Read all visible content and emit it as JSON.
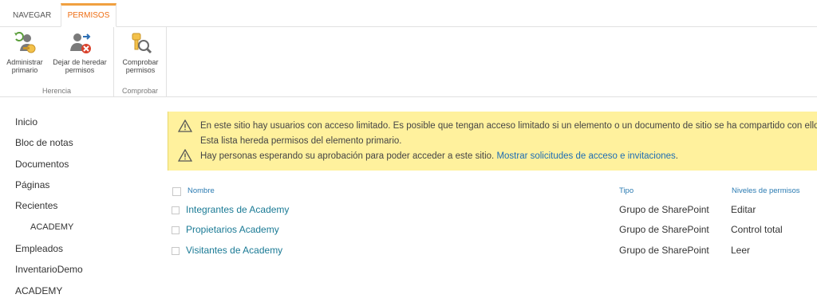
{
  "ribbon": {
    "tabs": [
      {
        "label": "NAVEGAR"
      },
      {
        "label": "PERMISOS",
        "active": true
      }
    ],
    "groups": {
      "herencia": {
        "label": "Herencia",
        "buttons": [
          {
            "line1": "Administrar",
            "line2": "primario",
            "icon": "manage-parent-icon"
          },
          {
            "line1": "Dejar de heredar",
            "line2": "permisos",
            "icon": "stop-inheriting-icon"
          }
        ]
      },
      "comprobar": {
        "label": "Comprobar",
        "buttons": [
          {
            "line1": "Comprobar",
            "line2": "permisos",
            "icon": "check-permissions-icon"
          }
        ]
      }
    }
  },
  "leftnav": {
    "items": [
      {
        "label": "Inicio"
      },
      {
        "label": "Bloc de notas"
      },
      {
        "label": "Documentos"
      },
      {
        "label": "Páginas"
      },
      {
        "label": "Recientes"
      },
      {
        "label": "ACADEMY",
        "sub": true
      },
      {
        "label": "Empleados"
      },
      {
        "label": "InventarioDemo"
      },
      {
        "label": "ACADEMY"
      }
    ]
  },
  "status": {
    "line1": "En este sitio hay usuarios con acceso limitado. Es posible que tengan acceso limitado si un elemento o un documento de sitio se ha compartido con ellos.",
    "line2": "Esta lista hereda permisos del elemento primario.",
    "line3_text": "Hay personas esperando su aprobación para poder acceder a este sitio.",
    "line3_link": "Mostrar solicitudes de acceso e invitaciones",
    "line3_end": ".",
    "background": "#fff19d"
  },
  "table": {
    "headers": {
      "name": "Nombre",
      "type": "Tipo",
      "levels": "Niveles de permisos"
    },
    "rows": [
      {
        "name": "Integrantes de Academy",
        "type": "Grupo de SharePoint",
        "level": "Editar"
      },
      {
        "name": "Propietarios Academy",
        "type": "Grupo de SharePoint",
        "level": "Control total"
      },
      {
        "name": "Visitantes de Academy",
        "type": "Grupo de SharePoint",
        "level": "Leer"
      }
    ]
  },
  "colors": {
    "accent": "#ee6e14",
    "link": "#1a7a95"
  }
}
